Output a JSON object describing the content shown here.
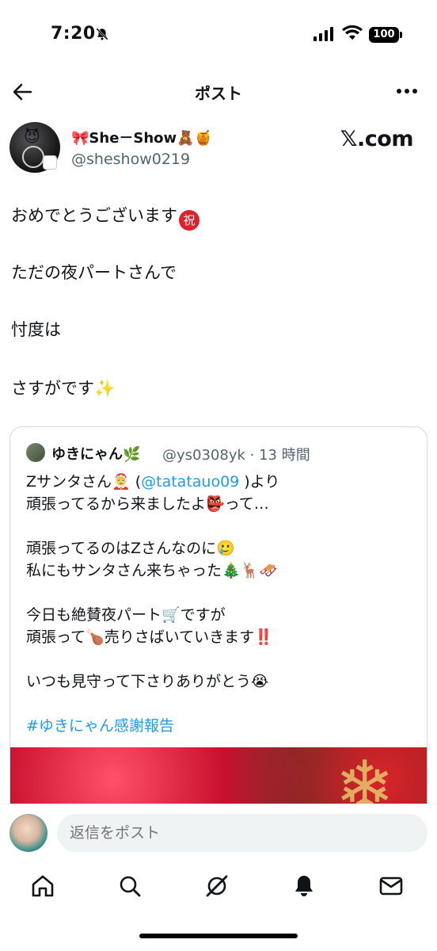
{
  "status_bar": {
    "time": "7:20",
    "battery": "100"
  },
  "header": {
    "title": "ポスト"
  },
  "author": {
    "display_name": "🎀She－Show🧸🍯",
    "handle": "@sheshow0219",
    "badge": "𝕏.com"
  },
  "post": {
    "lines": [
      "おめでとうございます",
      "ただの夜パートさんで",
      "忖度は",
      "さすがです✨"
    ],
    "iwai_emoji": "祝"
  },
  "quote": {
    "name": "ゆきにゃん🌿",
    "handle_time": "@ys0308yk · 13 時間",
    "line1_pre": "Zサンタさん🤶 (",
    "mention": "@tatatauo09",
    "line1_post": " )より",
    "line2": "頑張ってるから来ましたよ👺って…",
    "line3": "頑張ってるのはZさんなのに🥲",
    "line4": "私にもサンタさん来ちゃった🎄🦌🛷",
    "line5": "今日も絶賛夜パート🛒ですが",
    "line6": "頑張って🍗売りさばいていきます‼️",
    "line7": "いつも見守って下さりありがとう😭",
    "hashtag": "#ゆきにゃん感謝報告"
  },
  "reply": {
    "placeholder": "返信をポスト"
  },
  "nav": [
    "home-icon",
    "search-icon",
    "grok-icon",
    "notifications-icon",
    "messages-icon"
  ]
}
